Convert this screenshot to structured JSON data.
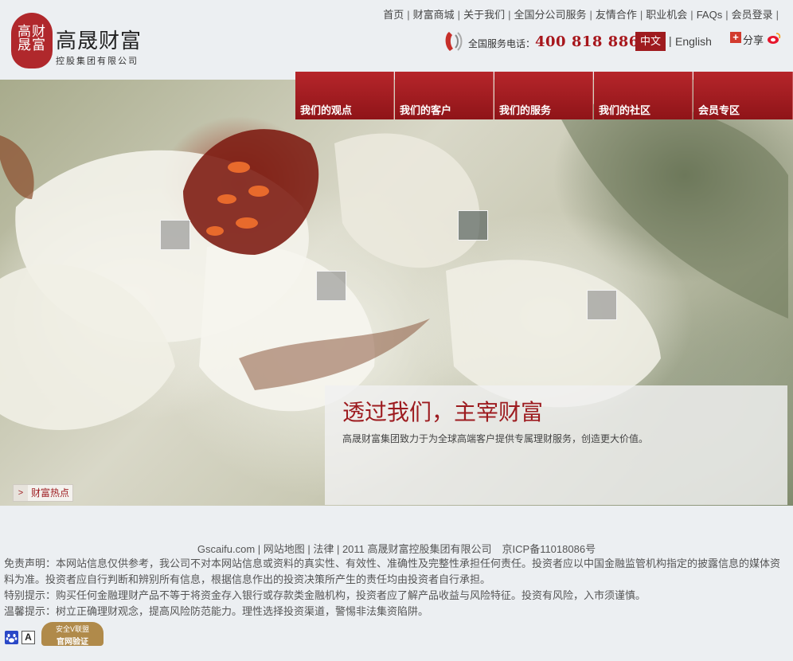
{
  "brand": {
    "seal_line1": "高财",
    "seal_line2": "晟富",
    "name": "高晟财富",
    "subname": "控股集团有限公司"
  },
  "topnav": [
    "首页",
    "财富商城",
    "关于我们",
    "全国分公司服务",
    "友情合作",
    "职业机会",
    "FAQs",
    "会员登录"
  ],
  "hotline": {
    "label": "全国服务电话：",
    "number": "400 818 8866"
  },
  "language": {
    "zh": "中文",
    "separator": "|",
    "en": "English"
  },
  "share": {
    "label": "分享",
    "plus": "+"
  },
  "mainnav": [
    "我们的观点",
    "我们的客户",
    "我们的服务",
    "我们的社区",
    "会员专区"
  ],
  "hero": {
    "title": "透过我们，主宰财富",
    "text": "高晟财富集团致力于为全球高端客户提供专属理财服务，创造更大价值。",
    "hot_tag": "财富热点",
    "hot_arrow": ">"
  },
  "footer": {
    "links": "Gscaifu.com | 网站地图 | 法律 | 2011 高晟财富控股集团有限公司　京ICP备11018086号",
    "disclaimer": "免责声明：本网站信息仅供参考，我公司不对本网站信息或资料的真实性、有效性、准确性及完整性承担任何责任。投资者应以中国金融监管机构指定的披露信息的媒体资料为准。投资者应自行判断和辨别所有信息，根据信息作出的投资决策所产生的责任均由投资者自行承担。",
    "special": "特别提示：购买任何金融理财产品不等于将资金存入银行或存款类金融机构，投资者应了解产品收益与风险特征。投资有风险，入市须谨慎。",
    "reminder": "温馨提示：树立正确理财观念，提高风险防范能力。理性选择投资渠道，警惕非法集资陷阱。",
    "badge_a": "A",
    "verify_line1": "安全V联盟",
    "verify_line2": "官网验证"
  },
  "colors": {
    "brand_red": "#9f1b1f",
    "nav_red": "#a51f24",
    "page_bg": "#eceff2"
  },
  "icons": [
    "phone-icon",
    "weibo-icon",
    "share-plus-icon",
    "baidu-paw-icon"
  ]
}
